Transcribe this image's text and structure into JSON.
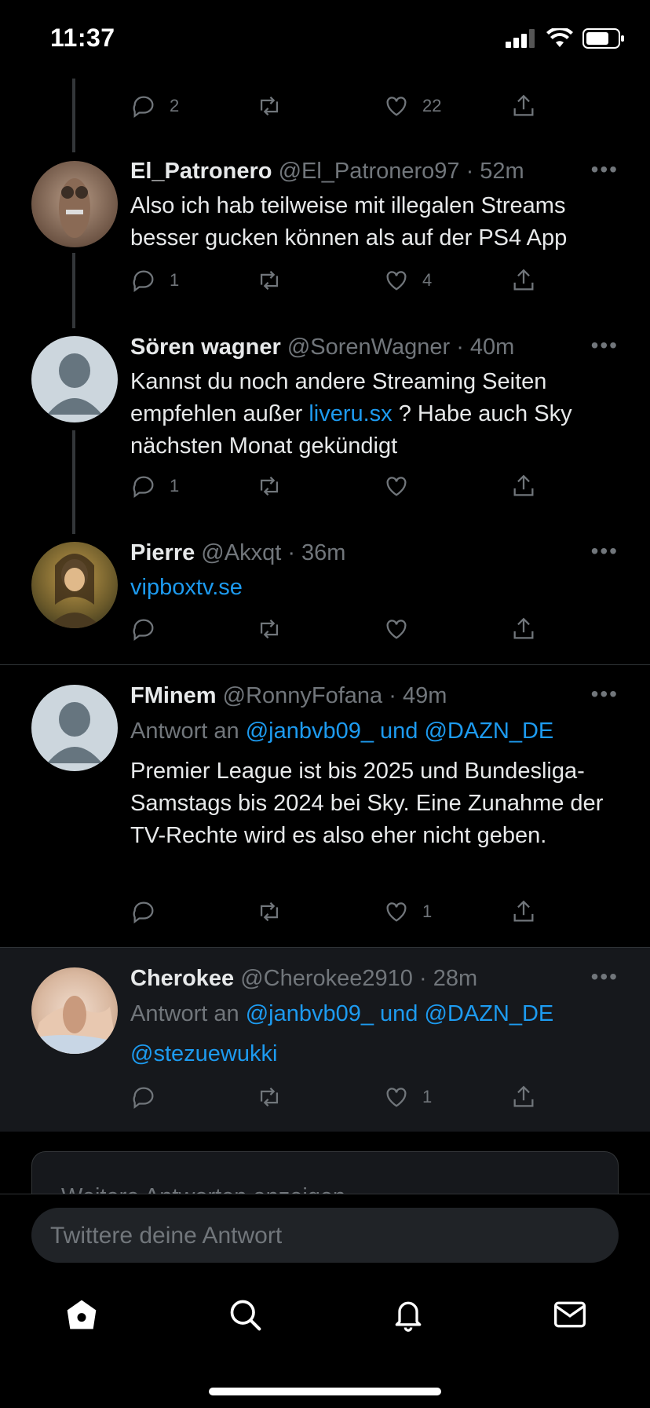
{
  "status": {
    "time": "11:37"
  },
  "top_counts": {
    "replies": "2",
    "likes": "22"
  },
  "tweets": [
    {
      "name": "El_Patronero",
      "handle": "@El_Patronero97 · 52m",
      "text": "Also ich hab teilweise mit illegalen Streams besser gucken können als auf der PS4 App",
      "replies": "1",
      "likes": "4"
    },
    {
      "name": "Sören wagner",
      "handle": "@SorenWagner · 40m",
      "text_before": "Kannst du noch andere Streaming Seiten empfehlen außer ",
      "link": "liveru.sx",
      "text_after": " ? Habe auch Sky nächsten Monat gekündigt",
      "replies": "1"
    },
    {
      "name": "Pierre",
      "handle": "@Akxqt · 36m",
      "link": "vipboxtv.se"
    },
    {
      "name": "FMinem",
      "handle": "@RonnyFofana · 49m",
      "reply_prefix": "Antwort an ",
      "reply_targets": "@janbvb09_ und @DAZN_DE",
      "text": "Premier League ist bis 2025 und Bundesliga-Samstags bis 2024 bei Sky. Eine Zunahme der TV-Rechte wird es also eher nicht geben.",
      "likes": "1"
    },
    {
      "name": "Cherokee",
      "handle": "@Cherokee2910 · 28m",
      "reply_prefix": "Antwort an ",
      "reply_targets": "@janbvb09_ und @DAZN_DE",
      "mention": "@stezuewukki",
      "likes": "1"
    }
  ],
  "more_replies": "Weitere Antworten anzeigen",
  "compose_placeholder": "Twittere deine Antwort",
  "nav": [
    "home-icon",
    "search-icon",
    "bell-icon",
    "mail-icon"
  ],
  "colors": {
    "accent": "#1d9bf0",
    "muted": "#71767b",
    "bg": "#000000"
  }
}
